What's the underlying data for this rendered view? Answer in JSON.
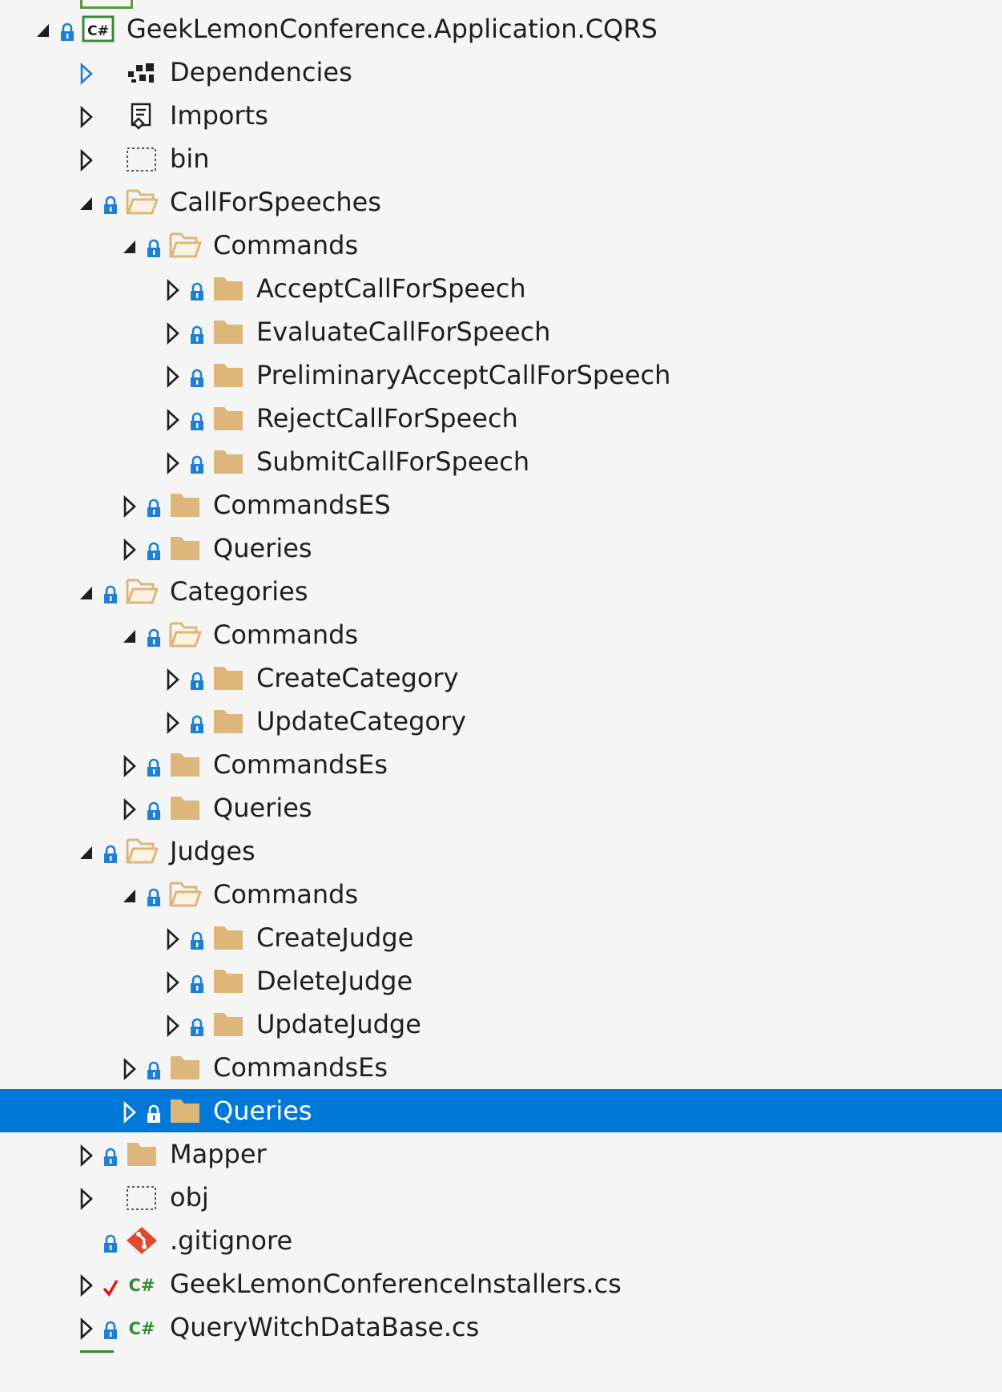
{
  "explorer": {
    "rows": [
      {
        "label": "GeekLemonConference.Application.CQRS",
        "indent": 0,
        "arrow": "expanded",
        "lock": true,
        "icon": "csharp-project"
      },
      {
        "label": "Dependencies",
        "indent": 1,
        "arrow": "collapsed-blue",
        "lock": false,
        "icon": "dependencies"
      },
      {
        "label": "Imports",
        "indent": 1,
        "arrow": "collapsed",
        "lock": false,
        "icon": "imports"
      },
      {
        "label": "bin",
        "indent": 1,
        "arrow": "collapsed",
        "lock": false,
        "icon": "dashed-folder"
      },
      {
        "label": "CallForSpeeches",
        "indent": 1,
        "arrow": "expanded",
        "lock": true,
        "icon": "open-folder"
      },
      {
        "label": "Commands",
        "indent": 2,
        "arrow": "expanded",
        "lock": true,
        "icon": "open-folder"
      },
      {
        "label": "AcceptCallForSpeech",
        "indent": 3,
        "arrow": "collapsed",
        "lock": true,
        "icon": "folder"
      },
      {
        "label": "EvaluateCallForSpeech",
        "indent": 3,
        "arrow": "collapsed",
        "lock": true,
        "icon": "folder"
      },
      {
        "label": "PreliminaryAcceptCallForSpeech",
        "indent": 3,
        "arrow": "collapsed",
        "lock": true,
        "icon": "folder"
      },
      {
        "label": "RejectCallForSpeech",
        "indent": 3,
        "arrow": "collapsed",
        "lock": true,
        "icon": "folder"
      },
      {
        "label": "SubmitCallForSpeech",
        "indent": 3,
        "arrow": "collapsed",
        "lock": true,
        "icon": "folder"
      },
      {
        "label": "CommandsES",
        "indent": 2,
        "arrow": "collapsed",
        "lock": true,
        "icon": "folder"
      },
      {
        "label": "Queries",
        "indent": 2,
        "arrow": "collapsed",
        "lock": true,
        "icon": "folder"
      },
      {
        "label": "Categories",
        "indent": 1,
        "arrow": "expanded",
        "lock": true,
        "icon": "open-folder"
      },
      {
        "label": "Commands",
        "indent": 2,
        "arrow": "expanded",
        "lock": true,
        "icon": "open-folder"
      },
      {
        "label": "CreateCategory",
        "indent": 3,
        "arrow": "collapsed",
        "lock": true,
        "icon": "folder"
      },
      {
        "label": "UpdateCategory",
        "indent": 3,
        "arrow": "collapsed",
        "lock": true,
        "icon": "folder"
      },
      {
        "label": "CommandsEs",
        "indent": 2,
        "arrow": "collapsed",
        "lock": true,
        "icon": "folder"
      },
      {
        "label": "Queries",
        "indent": 2,
        "arrow": "collapsed",
        "lock": true,
        "icon": "folder"
      },
      {
        "label": "Judges",
        "indent": 1,
        "arrow": "expanded",
        "lock": true,
        "icon": "open-folder"
      },
      {
        "label": "Commands",
        "indent": 2,
        "arrow": "expanded",
        "lock": true,
        "icon": "open-folder"
      },
      {
        "label": "CreateJudge",
        "indent": 3,
        "arrow": "collapsed",
        "lock": true,
        "icon": "folder"
      },
      {
        "label": "DeleteJudge",
        "indent": 3,
        "arrow": "collapsed",
        "lock": true,
        "icon": "folder"
      },
      {
        "label": "UpdateJudge",
        "indent": 3,
        "arrow": "collapsed",
        "lock": true,
        "icon": "folder"
      },
      {
        "label": "CommandsEs",
        "indent": 2,
        "arrow": "collapsed",
        "lock": true,
        "icon": "folder"
      },
      {
        "label": "Queries",
        "indent": 2,
        "arrow": "collapsed",
        "lock": true,
        "icon": "folder",
        "selected": true
      },
      {
        "label": "Mapper",
        "indent": 1,
        "arrow": "collapsed",
        "lock": true,
        "icon": "folder"
      },
      {
        "label": "obj",
        "indent": 1,
        "arrow": "collapsed",
        "lock": false,
        "icon": "dashed-folder"
      },
      {
        "label": ".gitignore",
        "indent": 1,
        "arrow": "none",
        "lock": true,
        "icon": "git-file"
      },
      {
        "label": "GeekLemonConferenceInstallers.cs",
        "indent": 1,
        "arrow": "collapsed",
        "lock": false,
        "checkmark": true,
        "icon": "csharp-file"
      },
      {
        "label": "QueryWitchDataBase.cs",
        "indent": 1,
        "arrow": "collapsed",
        "lock": true,
        "icon": "csharp-file"
      }
    ]
  },
  "colors": {
    "selection": "#0078d7",
    "lock": "#1e7fd8",
    "folder": "#dcb67a",
    "checkmark": "#e51400",
    "csharp": "#388a34",
    "git": "#e2482f"
  }
}
